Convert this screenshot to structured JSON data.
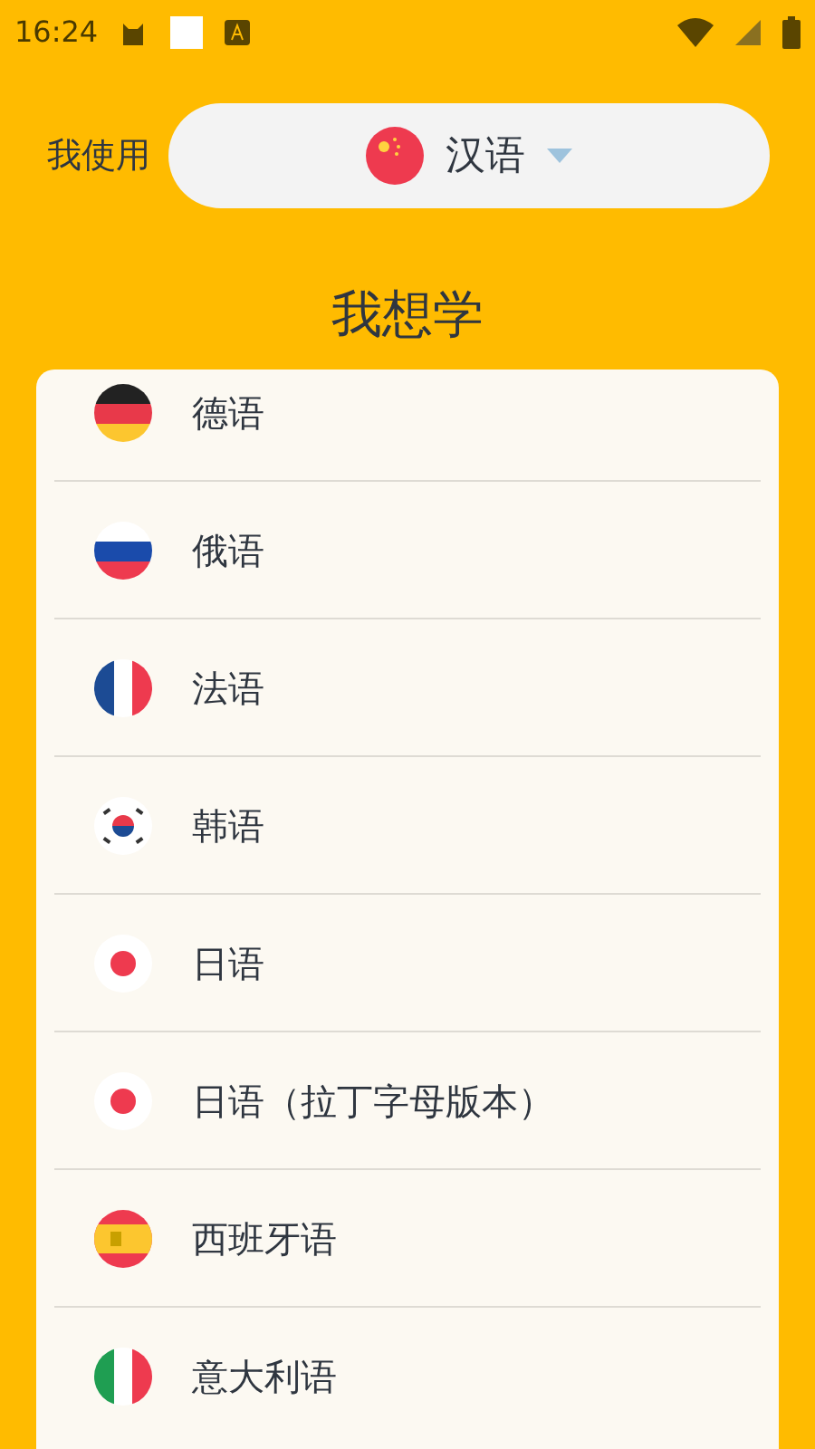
{
  "status_bar": {
    "time": "16:24"
  },
  "native": {
    "label": "我使用",
    "kind": "cn",
    "language": "汉语"
  },
  "heading": "我想学",
  "languages": [
    {
      "kind": "de",
      "name": "德语"
    },
    {
      "kind": "ru",
      "name": "俄语"
    },
    {
      "kind": "fr",
      "name": "法语"
    },
    {
      "kind": "kr",
      "name": "韩语"
    },
    {
      "kind": "jp",
      "name": "日语"
    },
    {
      "kind": "jp",
      "name": "日语（拉丁字母版本）"
    },
    {
      "kind": "es",
      "name": "西班牙语"
    },
    {
      "kind": "it",
      "name": "意大利语"
    }
  ]
}
